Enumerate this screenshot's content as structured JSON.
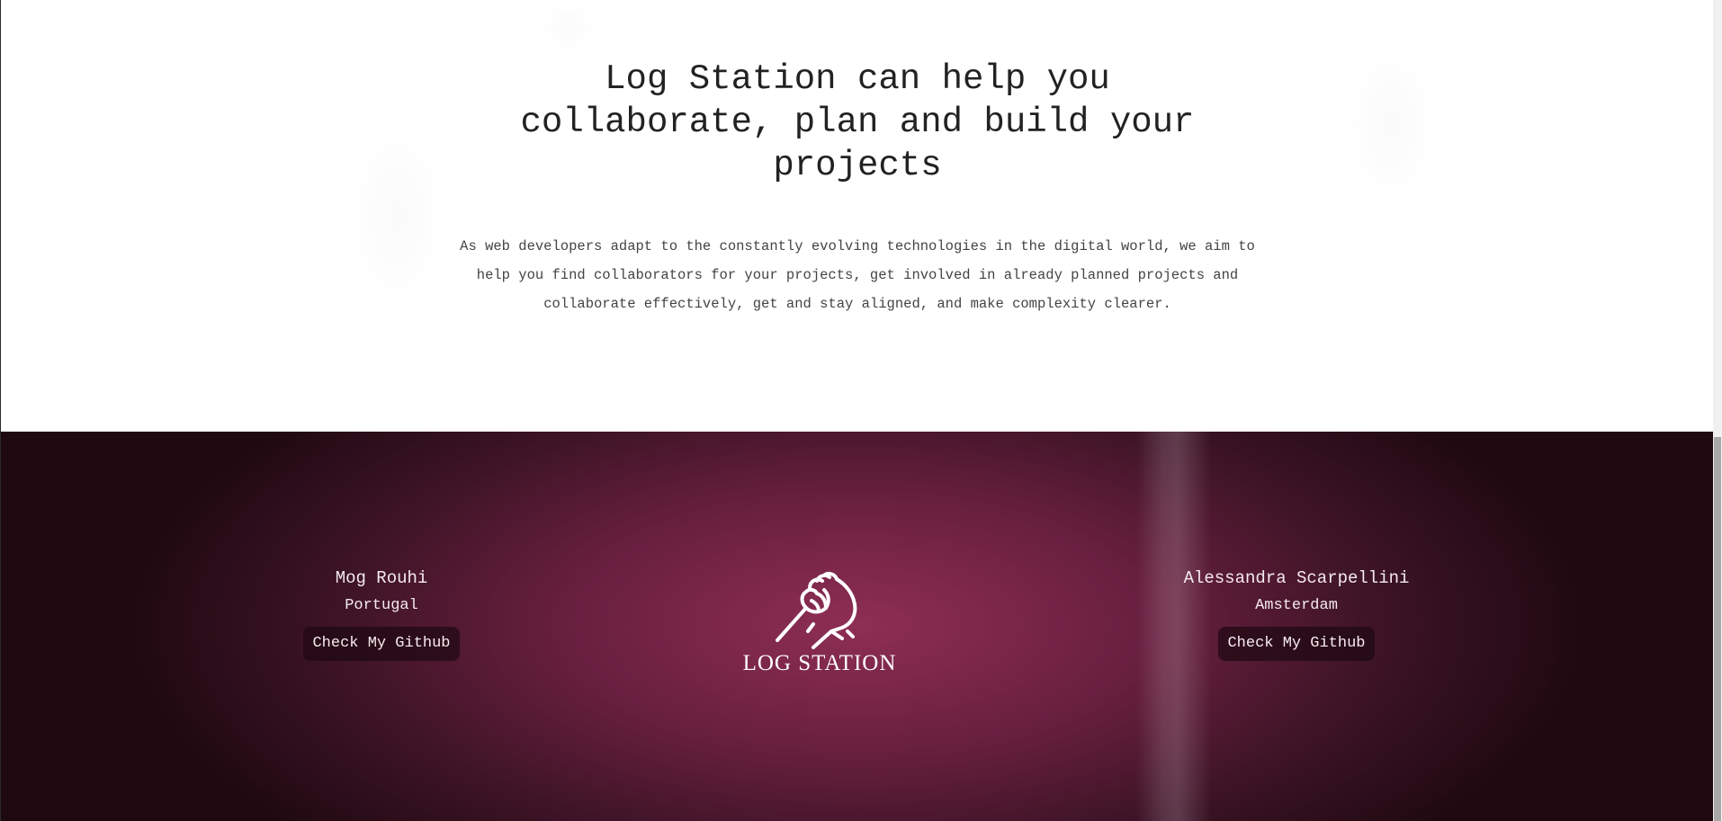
{
  "intro": {
    "title_lines": [
      "Log Station can help you",
      "collaborate, plan and build your",
      "projects"
    ],
    "text_lines": [
      "As web developers adapt to the constantly evolving technologies in the digital world, we aim to",
      "help you find collaborators for your projects, get involved in already planned projects and",
      "collaborate effectively, get and stay aligned, and make complexity clearer."
    ]
  },
  "footer": {
    "colors": {
      "accent": "#8e2e54",
      "dark": "#1e0910",
      "button_bg": "#2a0c18"
    },
    "left_person": {
      "name": "Mog Rouhi",
      "location": "Portugal",
      "button_label": "Check My Github"
    },
    "brand": {
      "logo_icon": "handshake-icon",
      "name": "LOG STATION"
    },
    "right_person": {
      "name": "Alessandra Scarpellini",
      "location": "Amsterdam",
      "button_label": "Check My Github"
    }
  }
}
